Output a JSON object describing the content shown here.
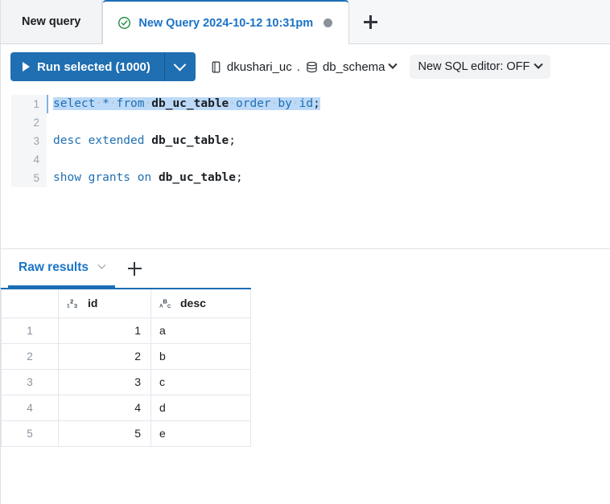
{
  "tabs": {
    "inactive_label": "New query",
    "active": {
      "label": "New Query 2024-10-12 10:31pm",
      "status_icon": "check-circle-icon",
      "dirty_icon": "unsaved-dot-icon"
    },
    "new_tab_icon": "plus-icon"
  },
  "toolbar": {
    "run_label": "Run selected  (1000)",
    "run_play_icon": "play-icon",
    "run_caret_icon": "chevron-down-icon",
    "catalog_icon": "catalog-icon",
    "catalog": "dkushari_uc",
    "separator": ".",
    "schema_icon": "database-icon",
    "schema": "db_schema",
    "catalog_caret_icon": "chevron-down-icon",
    "sql_toggle_label": "New SQL editor: OFF",
    "sql_toggle_caret_icon": "chevron-down-icon"
  },
  "editor": {
    "lines": [
      {
        "n": "1",
        "selected": true,
        "tokens": [
          {
            "t": "select",
            "c": "kw"
          },
          {
            "t": "·",
            "c": "dot"
          },
          {
            "t": "*",
            "c": "kw"
          },
          {
            "t": "·",
            "c": "dot"
          },
          {
            "t": "from",
            "c": "kw"
          },
          {
            "t": "·",
            "c": "dot"
          },
          {
            "t": "db_uc_table",
            "c": "ident"
          },
          {
            "t": "·",
            "c": "dot"
          },
          {
            "t": "order",
            "c": "kw"
          },
          {
            "t": "·",
            "c": "dot"
          },
          {
            "t": "by",
            "c": "kw"
          },
          {
            "t": "·",
            "c": "dot"
          },
          {
            "t": "id",
            "c": "kw"
          },
          {
            "t": ";",
            "c": "punct"
          }
        ]
      },
      {
        "n": "2",
        "selected": false,
        "tokens": []
      },
      {
        "n": "3",
        "selected": false,
        "tokens": [
          {
            "t": "desc extended ",
            "c": "kw"
          },
          {
            "t": "db_uc_table",
            "c": "ident"
          },
          {
            "t": ";",
            "c": "punct"
          }
        ]
      },
      {
        "n": "4",
        "selected": false,
        "tokens": []
      },
      {
        "n": "5",
        "selected": false,
        "tokens": [
          {
            "t": "show grants on ",
            "c": "kw"
          },
          {
            "t": "db_uc_table",
            "c": "ident"
          },
          {
            "t": ";",
            "c": "punct"
          }
        ]
      }
    ]
  },
  "results": {
    "tab_label": "Raw results",
    "tab_caret_icon": "chevron-down-icon",
    "add_icon": "plus-icon",
    "columns": [
      {
        "label": "",
        "type_icon": "",
        "align": "rownum"
      },
      {
        "label": "id",
        "type_icon": "numeric-type-icon",
        "align": "num"
      },
      {
        "label": "desc",
        "type_icon": "string-type-icon",
        "align": "txt"
      }
    ],
    "rows": [
      {
        "n": "1",
        "id": "1",
        "desc": "a"
      },
      {
        "n": "2",
        "id": "2",
        "desc": "b"
      },
      {
        "n": "3",
        "id": "3",
        "desc": "c"
      },
      {
        "n": "4",
        "id": "4",
        "desc": "d"
      },
      {
        "n": "5",
        "id": "5",
        "desc": "e"
      }
    ]
  },
  "colors": {
    "accent_blue": "#1f6fb2",
    "link_blue": "#1a73c7",
    "success_green": "#1b873f",
    "dirty_gray": "#8a9199"
  }
}
